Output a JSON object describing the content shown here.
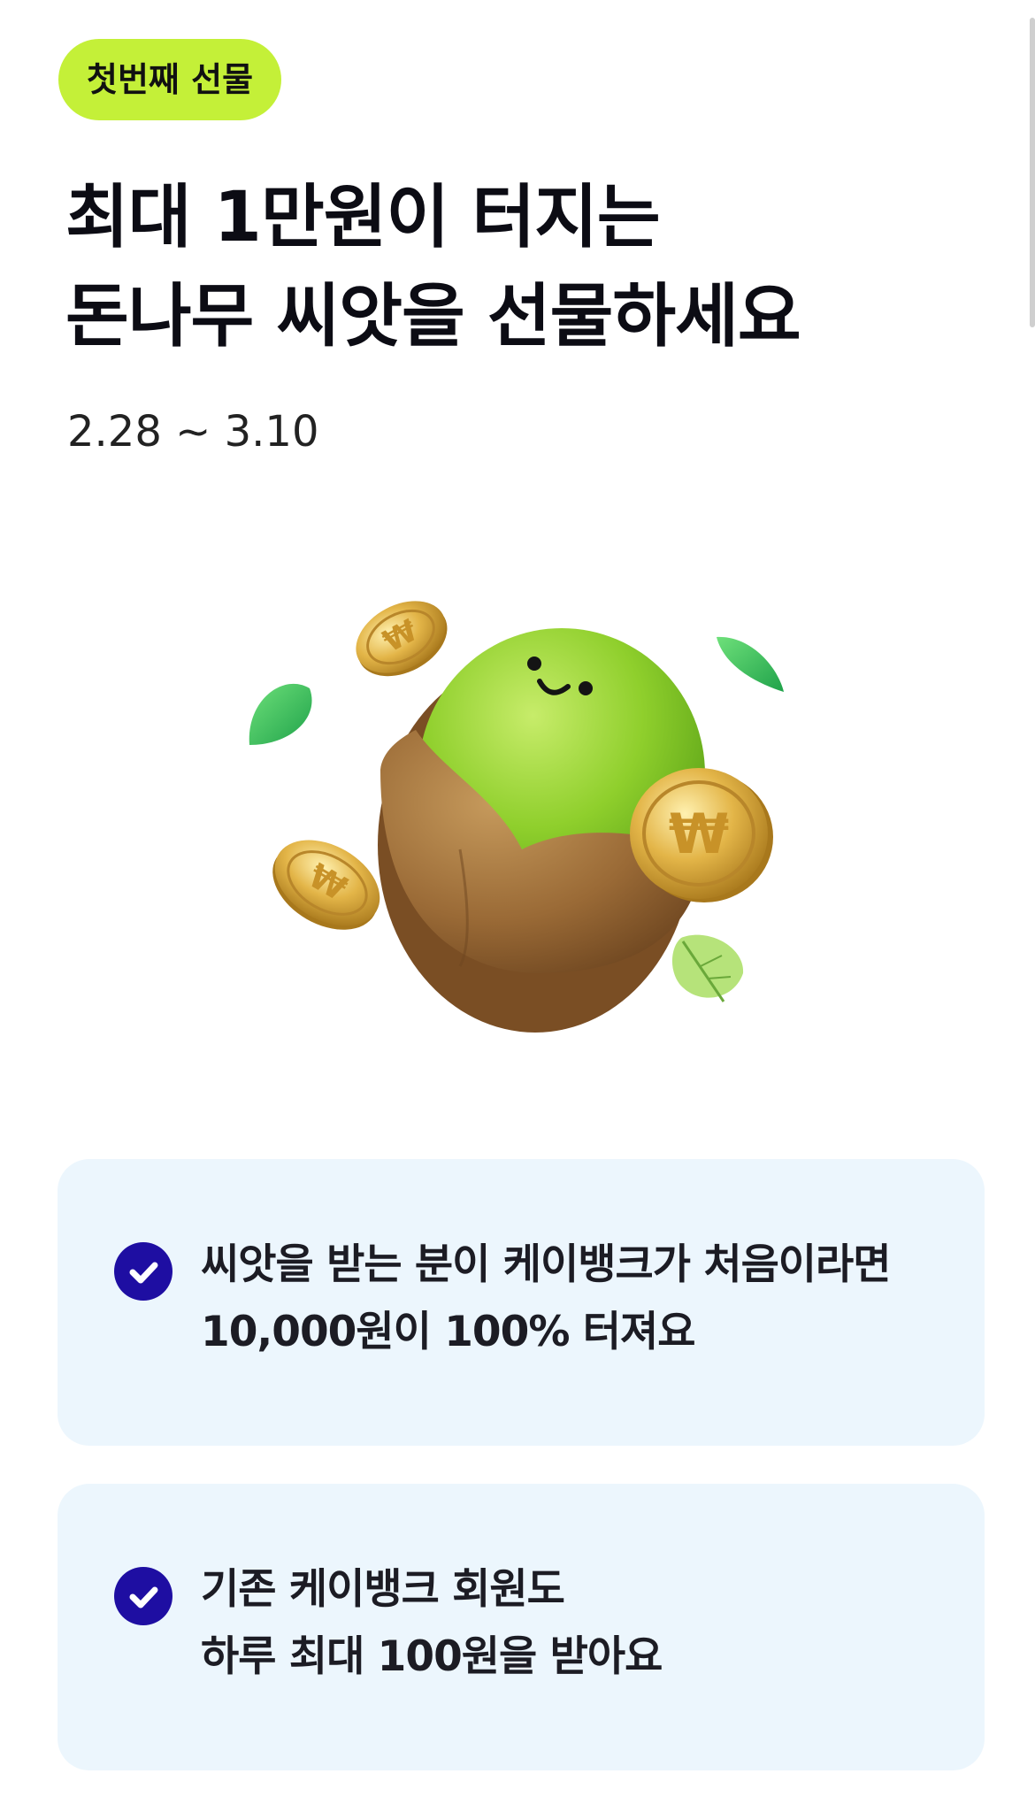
{
  "badge": {
    "label": "첫번째 선물",
    "color": "#c4f038"
  },
  "headline": {
    "line1": "최대 1만원이 터지는",
    "line2": "돈나무 씨앗을 선물하세요"
  },
  "period": "2.28 ~ 3.10",
  "hero": {
    "icon": "seed-character-with-coins-icon",
    "coin_symbol": "₩"
  },
  "benefits": [
    {
      "icon": "check-circle-icon",
      "line1": "씨앗을 받는 분이 케이뱅크가 처음이라면",
      "line2": "10,000원이 100% 터져요"
    },
    {
      "icon": "check-circle-icon",
      "line1": "기존 케이뱅크 회원도",
      "line2": "하루 최대 100원을 받아요"
    }
  ],
  "colors": {
    "accent": "#c4f038",
    "check": "#1e0ea2",
    "card_bg": "#ecf6fd",
    "text": "#111111"
  }
}
